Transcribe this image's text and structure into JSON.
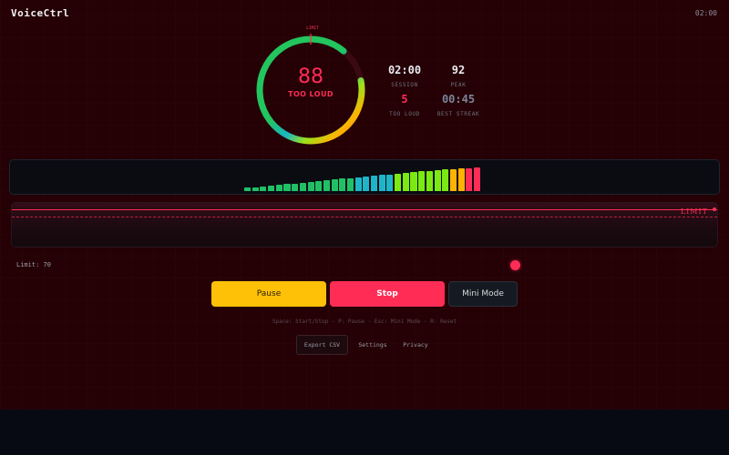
{
  "app": {
    "title": "VoiceCtrl",
    "clock": "02:00"
  },
  "gauge": {
    "value": "88",
    "status": "TOO LOUD",
    "limit_label": "LIMIT",
    "level_fraction": 0.88,
    "limit_fraction": 0.7
  },
  "stats": {
    "session": {
      "value": "02:00",
      "label": "SESSION"
    },
    "peak": {
      "value": "92",
      "label": "PEAK"
    },
    "too_loud": {
      "value": "5",
      "label": "TOO LOUD"
    },
    "best_streak": {
      "value": "00:45",
      "label": "BEST STREAK"
    }
  },
  "spectrum": {
    "levels": [
      0.14,
      0.17,
      0.2,
      0.24,
      0.26,
      0.29,
      0.32,
      0.35,
      0.39,
      0.42,
      0.45,
      0.49,
      0.52,
      0.55,
      0.58,
      0.62,
      0.65,
      0.68,
      0.71,
      0.74,
      0.77,
      0.8,
      0.83,
      0.86,
      0.89,
      0.92,
      0.94,
      0.96,
      0.98,
      1.0
    ],
    "colors": [
      "#21c066",
      "#21c066",
      "#21c066",
      "#21c066",
      "#21c066",
      "#21c066",
      "#21c066",
      "#21c066",
      "#21c066",
      "#21c066",
      "#21c066",
      "#21c066",
      "#21c066",
      "#21c066",
      "#1fb5c9",
      "#1fb5c9",
      "#1fb5c9",
      "#1fb5c9",
      "#1fb5c9",
      "#7bea13",
      "#7bea13",
      "#7bea13",
      "#7bea13",
      "#7bea13",
      "#7bea13",
      "#7bea13",
      "#ffb300",
      "#ffb300",
      "#ff2d55",
      "#ff2d55"
    ]
  },
  "history": {
    "limit_label": "LIMIT"
  },
  "limit": {
    "text": "Limit: 70",
    "value": 70
  },
  "buttons": {
    "pause": "Pause",
    "stop": "Stop",
    "mini": "Mini Mode"
  },
  "shortcuts": "Space: Start/Stop · P: Pause · Esc: Mini Mode · R: Reset",
  "footer": {
    "export": "Export CSV",
    "settings": "Settings",
    "privacy": "Privacy"
  },
  "colors": {
    "accent": "#ff2d55",
    "warning": "#ffc107",
    "background": "#250005"
  }
}
